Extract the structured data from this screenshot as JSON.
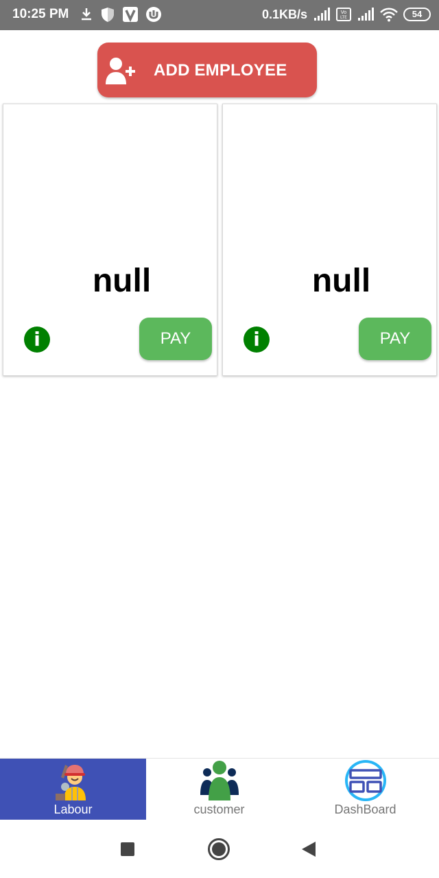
{
  "status_bar": {
    "time": "10:25 PM",
    "speed": "0.1KB/s",
    "battery": "54",
    "icons": [
      "download-icon",
      "shield-icon",
      "v-app-icon",
      "torrent-icon",
      "signal-icon",
      "volte-icon",
      "signal-icon",
      "wifi-icon",
      "battery-icon"
    ]
  },
  "header": {
    "add_button_label": "ADD EMPLOYEE",
    "add_button_color": "#d9534f"
  },
  "cards": [
    {
      "name": "null",
      "pay_label": "PAY",
      "info_label": "i"
    },
    {
      "name": "null",
      "pay_label": "PAY",
      "info_label": "i"
    }
  ],
  "colors": {
    "pay_button": "#5cb85c",
    "info_icon": "#008000",
    "active_nav": "#3f51b5"
  },
  "bottom_nav": {
    "items": [
      {
        "label": "Labour",
        "icon": "labour-worker-icon",
        "active": true
      },
      {
        "label": "customer",
        "icon": "customer-group-icon",
        "active": false
      },
      {
        "label": "DashBoard",
        "icon": "dashboard-icon",
        "active": false
      }
    ]
  },
  "system_nav": {
    "buttons": [
      "recents-square-icon",
      "home-circle-icon",
      "back-triangle-icon"
    ]
  }
}
